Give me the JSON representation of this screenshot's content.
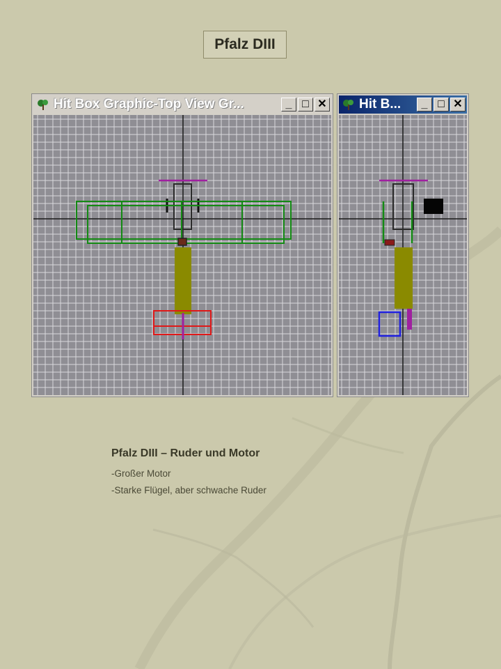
{
  "page": {
    "title": "Pfalz DIII"
  },
  "windows": {
    "top_view": {
      "title": "Hit Box Graphic-Top View  Gr...",
      "minimize_label": "_",
      "maximize_label": "□",
      "close_label": "✕"
    },
    "side_view": {
      "title": "Hit B...",
      "minimize_label": "_",
      "maximize_label": "□",
      "close_label": "✕"
    }
  },
  "description": {
    "heading": "Pfalz DIII – Ruder und Motor",
    "bullets": [
      "-Großer Motor",
      "-Starke Flügel, aber schwache Ruder"
    ]
  },
  "colors": {
    "background": "#cbc9ac",
    "grid_canvas": "#8f8e94",
    "wing_hitbox": "#138a13",
    "fuselage_hitbox": "#8a8a00",
    "tail_hitbox_top": "#e01818",
    "tail_hitbox_side": "#2020e0",
    "engine_hitbox": "#3a3a3a",
    "rudder_hitbox": "#a020a0"
  },
  "icons": {
    "window_icon": "plane-tree-icon",
    "minimize": "minimize-icon",
    "maximize": "maximize-icon",
    "close": "close-icon"
  }
}
